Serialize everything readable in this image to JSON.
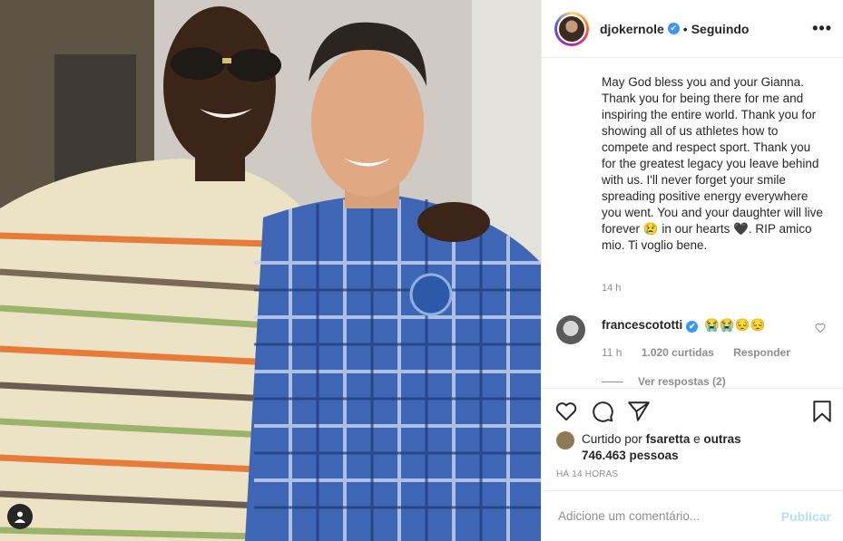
{
  "post": {
    "username": "djokernole",
    "verified_mark": "✔",
    "separator": "•",
    "follow_status": "Seguindo",
    "more_icon": "•••",
    "caption": "May God bless you and your Gianna. Thank you for being there for me and inspiring the entire world. Thank you for showing all of us athletes how to compete and respect sport. Thank you for the greatest legacy you leave behind with us. I'll never forget your smile spreading positive energy everywhere you went. You and your daughter will live forever 😢 in our hearts 🖤. RIP amico mio. Ti voglio bene.",
    "caption_time": "14 h"
  },
  "comment": {
    "username": "francescototti",
    "text": "😭😭😔😔",
    "time": "11 h",
    "likes": "1.020 curtidas",
    "reply": "Responder",
    "view_replies": "Ver respostas (2)"
  },
  "likes": {
    "prefix": "Curtido por",
    "user": "fsaretta",
    "joiner": "e",
    "others": "outras 746.463 pessoas"
  },
  "time_ago": "HÁ 14 HORAS",
  "add_comment": {
    "placeholder": "Adicione um comentário...",
    "publish_label": "Publicar"
  },
  "colors": {
    "verified": "#3897f0",
    "publish_disabled": "#b2dffc"
  }
}
